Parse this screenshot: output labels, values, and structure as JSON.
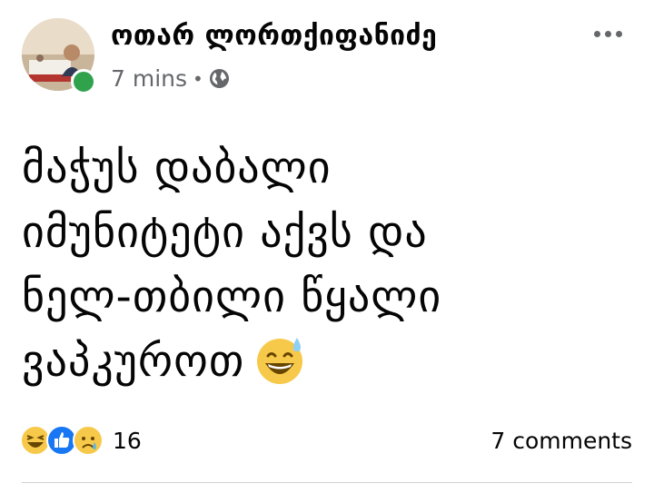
{
  "post": {
    "author_name": "ოთარ ლორთქიფანიძე",
    "timestamp": "7 mins",
    "separator": "•",
    "privacy_icon": "globe-icon",
    "author_online": true,
    "text": "მაჭუს დაბალი\nიმუნიტეტი აქვს და\nნელ-თბილი წყალი\nვაპკუროთ",
    "trailing_emoji": "grinning-face-with-sweat"
  },
  "reactions": {
    "icons": [
      "laughing-face-icon",
      "like-icon",
      "sad-face-icon"
    ],
    "count": "16"
  },
  "footer": {
    "comments_label": "7 comments"
  },
  "colors": {
    "online_green": "#31a24c",
    "like_blue": "#1877f2",
    "reaction_yellow": "#f7c94b",
    "meta_gray": "#65676b"
  }
}
